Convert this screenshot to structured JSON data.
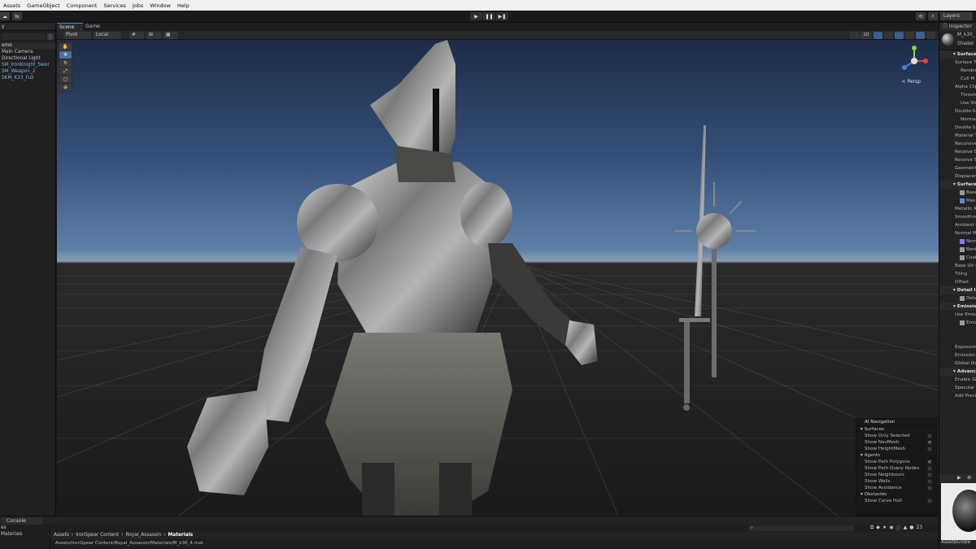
{
  "menu": [
    "Assets",
    "GameObject",
    "Component",
    "Services",
    "Jobs",
    "Window",
    "Help"
  ],
  "toolbar": {
    "layers": "Layers",
    "play": "▶",
    "pause": "❚❚",
    "step": "▶❚"
  },
  "hierarchy": {
    "tab": "y",
    "root": "emo",
    "items": [
      "Main Camera",
      "Directional Light",
      "SM_IronKnight_Swor",
      "SM_Weapon_2",
      "SKM_K33_Full"
    ]
  },
  "scene": {
    "tabs": [
      "Scene",
      "Game"
    ],
    "pivot": "Pivot",
    "local": "Local",
    "persp": "< Persp",
    "mode_2d": "2D"
  },
  "ai_navigation": {
    "title": "AI Navigation",
    "surfaces_label": "Surfaces",
    "surfaces": [
      {
        "label": "Show Only Selected",
        "checked": false
      },
      {
        "label": "Show NavMesh",
        "checked": true
      },
      {
        "label": "Show HeightMesh",
        "checked": false
      }
    ],
    "agents_label": "Agents",
    "agents": [
      {
        "label": "Show Path Polygons",
        "checked": true
      },
      {
        "label": "Show Path Query Nodes",
        "checked": false
      },
      {
        "label": "Show Neighbours",
        "checked": false
      },
      {
        "label": "Show Walls",
        "checked": false
      },
      {
        "label": "Show Avoidance",
        "checked": false
      }
    ],
    "obstacles_label": "Obstacles",
    "obstacles": [
      {
        "label": "Show Carve Hull",
        "checked": false
      }
    ]
  },
  "console": {
    "tab": "Console"
  },
  "project": {
    "left": [
      "es",
      "Materials"
    ],
    "breadcrumb": [
      "Assets",
      "IronSpear Content",
      "Royal_Assassin",
      "Materials"
    ],
    "path": "Assets/IronSpear Content/Royal_Assassin/Materials/M_k30_4.mat",
    "search_placeholder": "",
    "count": "23"
  },
  "inspector": {
    "tab": "Inspector",
    "name": "M_k30_",
    "shader": "Shader",
    "rows": [
      {
        "t": "hdr",
        "label": "Surface O"
      },
      {
        "t": "n",
        "label": "Surface T"
      },
      {
        "t": "ind",
        "label": "Render"
      },
      {
        "t": "ind",
        "label": "Cull M"
      },
      {
        "t": "n",
        "label": "Alpha Clip"
      },
      {
        "t": "ind",
        "label": "Thresh"
      },
      {
        "t": "ind",
        "label": "Use Sh"
      },
      {
        "t": "n",
        "label": "Double-S"
      },
      {
        "t": "ind",
        "label": "Normal"
      },
      {
        "t": "n",
        "label": "Double-S"
      },
      {
        "t": "n",
        "label": "Material T"
      },
      {
        "t": "n",
        "label": "Recursive"
      },
      {
        "t": "n",
        "label": "Receive D"
      },
      {
        "t": "n",
        "label": "Receive S"
      },
      {
        "t": "n",
        "label": "Geometric"
      },
      {
        "t": "n",
        "label": "Displacem"
      },
      {
        "t": "hdr",
        "label": "Surface In"
      },
      {
        "t": "tex",
        "label": "Base",
        "color": "#999999"
      },
      {
        "t": "tex",
        "label": "Mas",
        "color": "#4f8fd6"
      },
      {
        "t": "n",
        "label": "Metallic R"
      },
      {
        "t": "n",
        "label": "Smoothne"
      },
      {
        "t": "n",
        "label": "Ambient O"
      },
      {
        "t": "n",
        "label": "Normal M"
      },
      {
        "t": "tex",
        "label": "Norm",
        "color": "#8080ff"
      },
      {
        "t": "tex",
        "label": "Bent",
        "color": "#999999"
      },
      {
        "t": "tex",
        "label": "Coat",
        "color": "#999999"
      },
      {
        "t": "n",
        "label": "Base UV m"
      },
      {
        "t": "n",
        "label": "Tiling"
      },
      {
        "t": "n",
        "label": "Offset"
      },
      {
        "t": "hdr",
        "label": "Detail Inpu"
      },
      {
        "t": "tex",
        "label": "Detai",
        "color": "#999999"
      },
      {
        "t": "hdr",
        "label": "Emission I"
      },
      {
        "t": "n",
        "label": "Use Emissi"
      },
      {
        "t": "tex",
        "label": "Emis",
        "color": "#999999"
      },
      {
        "t": "n",
        "label": ""
      },
      {
        "t": "n",
        "label": ""
      },
      {
        "t": "n",
        "label": "Exposure"
      },
      {
        "t": "n",
        "label": "Emission"
      },
      {
        "t": "n",
        "label": "Global Illu"
      },
      {
        "t": "hdr",
        "label": "Advanced"
      },
      {
        "t": "n",
        "label": "Enable GP"
      },
      {
        "t": "n",
        "label": "Specular O"
      },
      {
        "t": "n",
        "label": "Add Preci"
      }
    ],
    "asset_bundle": "AssetBundle"
  }
}
